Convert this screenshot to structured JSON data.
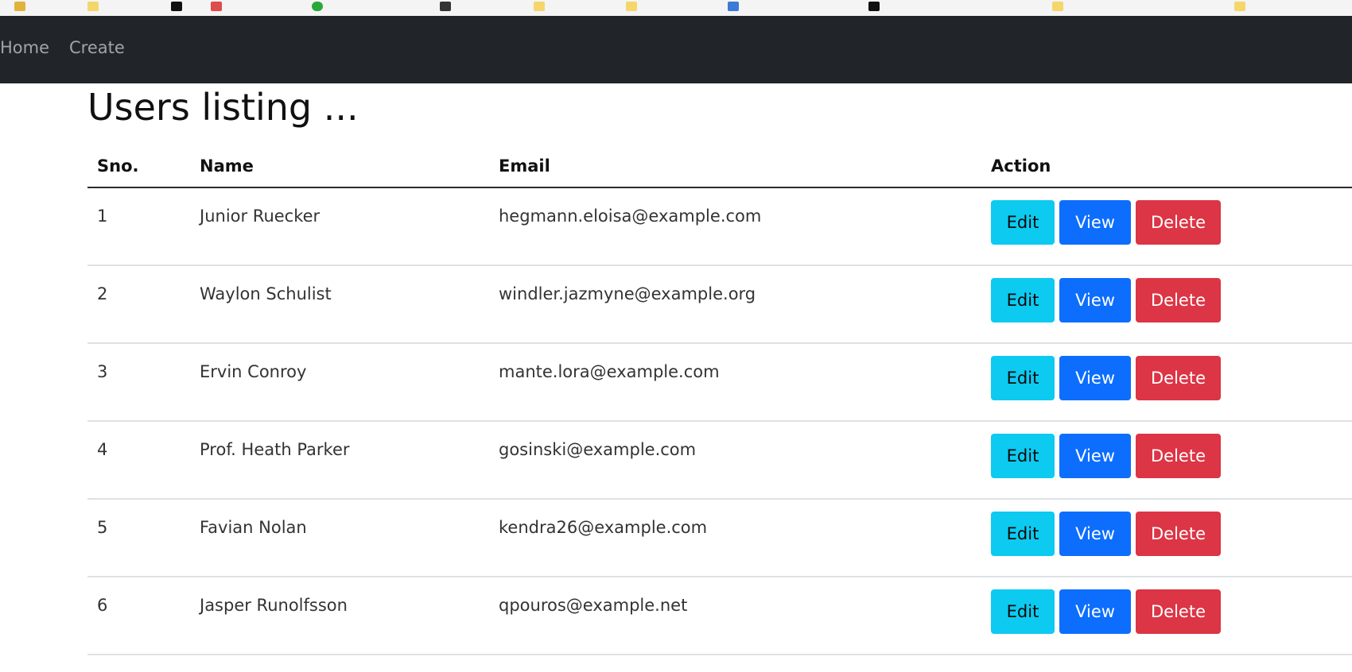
{
  "colors": {
    "navbar_bg": "#212529",
    "edit_button": "#0dcaf0",
    "view_button": "#0d6efd",
    "delete_button": "#dc3545"
  },
  "nav": {
    "items": [
      {
        "label": "Home"
      },
      {
        "label": "Create"
      }
    ]
  },
  "page": {
    "title": "Users listing ..."
  },
  "table": {
    "headers": {
      "sno": "Sno.",
      "name": "Name",
      "email": "Email",
      "action": "Action"
    },
    "actions": {
      "edit": "Edit",
      "view": "View",
      "delete": "Delete"
    },
    "rows": [
      {
        "sno": "1",
        "name": "Junior Ruecker",
        "email": "hegmann.eloisa@example.com"
      },
      {
        "sno": "2",
        "name": "Waylon Schulist",
        "email": "windler.jazmyne@example.org"
      },
      {
        "sno": "3",
        "name": "Ervin Conroy",
        "email": "mante.lora@example.com"
      },
      {
        "sno": "4",
        "name": "Prof. Heath Parker",
        "email": "gosinski@example.com"
      },
      {
        "sno": "5",
        "name": "Favian Nolan",
        "email": "kendra26@example.com"
      },
      {
        "sno": "6",
        "name": "Jasper Runolfsson",
        "email": "qpouros@example.net"
      }
    ]
  }
}
